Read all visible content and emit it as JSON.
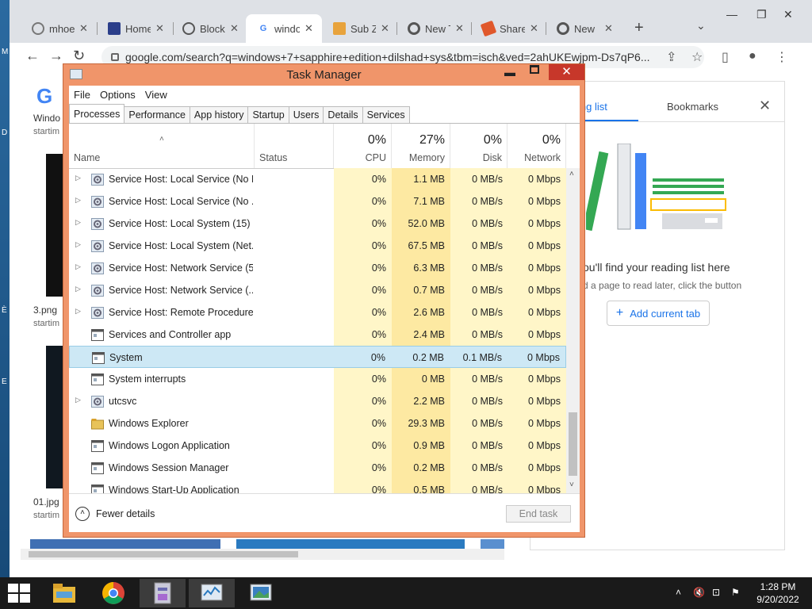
{
  "browser": {
    "tabs": [
      {
        "title": "mhoe",
        "color": "#777"
      },
      {
        "title": "Home",
        "color": "#2b3e8a"
      },
      {
        "title": "Block",
        "color": "#777"
      },
      {
        "title": "windo",
        "color": "#4285f4"
      },
      {
        "title": "Sub Z",
        "color": "#e8a33c"
      },
      {
        "title": "New T",
        "color": "#555"
      },
      {
        "title": "Share",
        "color": "#e0582b"
      },
      {
        "title": "New",
        "color": "#555"
      }
    ],
    "url": "google.com/search?q=windows+7+sapphire+edition+dilshad+sys&tbm=isch&ved=2ahUKEwjpm-Ds7qP6..."
  },
  "page": {
    "logo": "G",
    "results": [
      {
        "title": "Windo",
        "sub": "startim"
      },
      {
        "title": "3.png",
        "sub": "startim"
      },
      {
        "title": "01.jpg",
        "sub": "startim"
      }
    ]
  },
  "reading_list": {
    "tab_reading": "ing list",
    "tab_bookmarks": "Bookmarks",
    "message": "ou'll find your reading list here",
    "sub": "d a page to read later, click the button",
    "add_button": "Add current tab"
  },
  "task_manager": {
    "title": "Task Manager",
    "menu": [
      "File",
      "Options",
      "View"
    ],
    "tabs": [
      "Processes",
      "Performance",
      "App history",
      "Startup",
      "Users",
      "Details",
      "Services"
    ],
    "columns": {
      "name": "Name",
      "status": "Status",
      "cpu_pct": "0%",
      "cpu": "CPU",
      "mem_pct": "27%",
      "mem": "Memory",
      "disk_pct": "0%",
      "disk": "Disk",
      "net_pct": "0%",
      "net": "Network"
    },
    "rows": [
      {
        "name": "Service Host: Local Service (No I...",
        "cpu": "0%",
        "mem": "1.1 MB",
        "disk": "0 MB/s",
        "net": "0 Mbps",
        "expand": true,
        "icon": "gear"
      },
      {
        "name": "Service Host: Local Service (No ...",
        "cpu": "0%",
        "mem": "7.1 MB",
        "disk": "0 MB/s",
        "net": "0 Mbps",
        "expand": true,
        "icon": "gear"
      },
      {
        "name": "Service Host: Local System (15)",
        "cpu": "0%",
        "mem": "52.0 MB",
        "disk": "0 MB/s",
        "net": "0 Mbps",
        "expand": true,
        "icon": "gear"
      },
      {
        "name": "Service Host: Local System (Net...",
        "cpu": "0%",
        "mem": "67.5 MB",
        "disk": "0 MB/s",
        "net": "0 Mbps",
        "expand": true,
        "icon": "gear"
      },
      {
        "name": "Service Host: Network Service (5)",
        "cpu": "0%",
        "mem": "6.3 MB",
        "disk": "0 MB/s",
        "net": "0 Mbps",
        "expand": true,
        "icon": "gear"
      },
      {
        "name": "Service Host: Network Service (...",
        "cpu": "0%",
        "mem": "0.7 MB",
        "disk": "0 MB/s",
        "net": "0 Mbps",
        "expand": true,
        "icon": "gear"
      },
      {
        "name": "Service Host: Remote Procedure...",
        "cpu": "0%",
        "mem": "2.6 MB",
        "disk": "0 MB/s",
        "net": "0 Mbps",
        "expand": true,
        "icon": "gear"
      },
      {
        "name": "Services and Controller app",
        "cpu": "0%",
        "mem": "2.4 MB",
        "disk": "0 MB/s",
        "net": "0 Mbps",
        "expand": false,
        "icon": "window"
      },
      {
        "name": "System",
        "cpu": "0%",
        "mem": "0.2 MB",
        "disk": "0.1 MB/s",
        "net": "0 Mbps",
        "expand": false,
        "icon": "window",
        "selected": true
      },
      {
        "name": "System interrupts",
        "cpu": "0%",
        "mem": "0 MB",
        "disk": "0 MB/s",
        "net": "0 Mbps",
        "expand": false,
        "icon": "window"
      },
      {
        "name": "utcsvc",
        "cpu": "0%",
        "mem": "2.2 MB",
        "disk": "0 MB/s",
        "net": "0 Mbps",
        "expand": true,
        "icon": "gear"
      },
      {
        "name": "Windows Explorer",
        "cpu": "0%",
        "mem": "29.3 MB",
        "disk": "0 MB/s",
        "net": "0 Mbps",
        "expand": false,
        "icon": "folder"
      },
      {
        "name": "Windows Logon Application",
        "cpu": "0%",
        "mem": "0.9 MB",
        "disk": "0 MB/s",
        "net": "0 Mbps",
        "expand": false,
        "icon": "window"
      },
      {
        "name": "Windows Session Manager",
        "cpu": "0%",
        "mem": "0.2 MB",
        "disk": "0 MB/s",
        "net": "0 Mbps",
        "expand": false,
        "icon": "window"
      },
      {
        "name": "Windows Start-Up Application",
        "cpu": "0%",
        "mem": "0.5 MB",
        "disk": "0 MB/s",
        "net": "0 Mbps",
        "expand": false,
        "icon": "window"
      }
    ],
    "fewer_details": "Fewer details",
    "end_task": "End task"
  },
  "taskbar": {
    "time": "1:28 PM",
    "date": "9/20/2022"
  },
  "colors": {
    "tm_frame": "#f0956a",
    "tm_close": "#c7372a",
    "selected_row": "#cde8f5",
    "memory_highlight": "#fde9a2",
    "accent_blue": "#1a73e8"
  }
}
